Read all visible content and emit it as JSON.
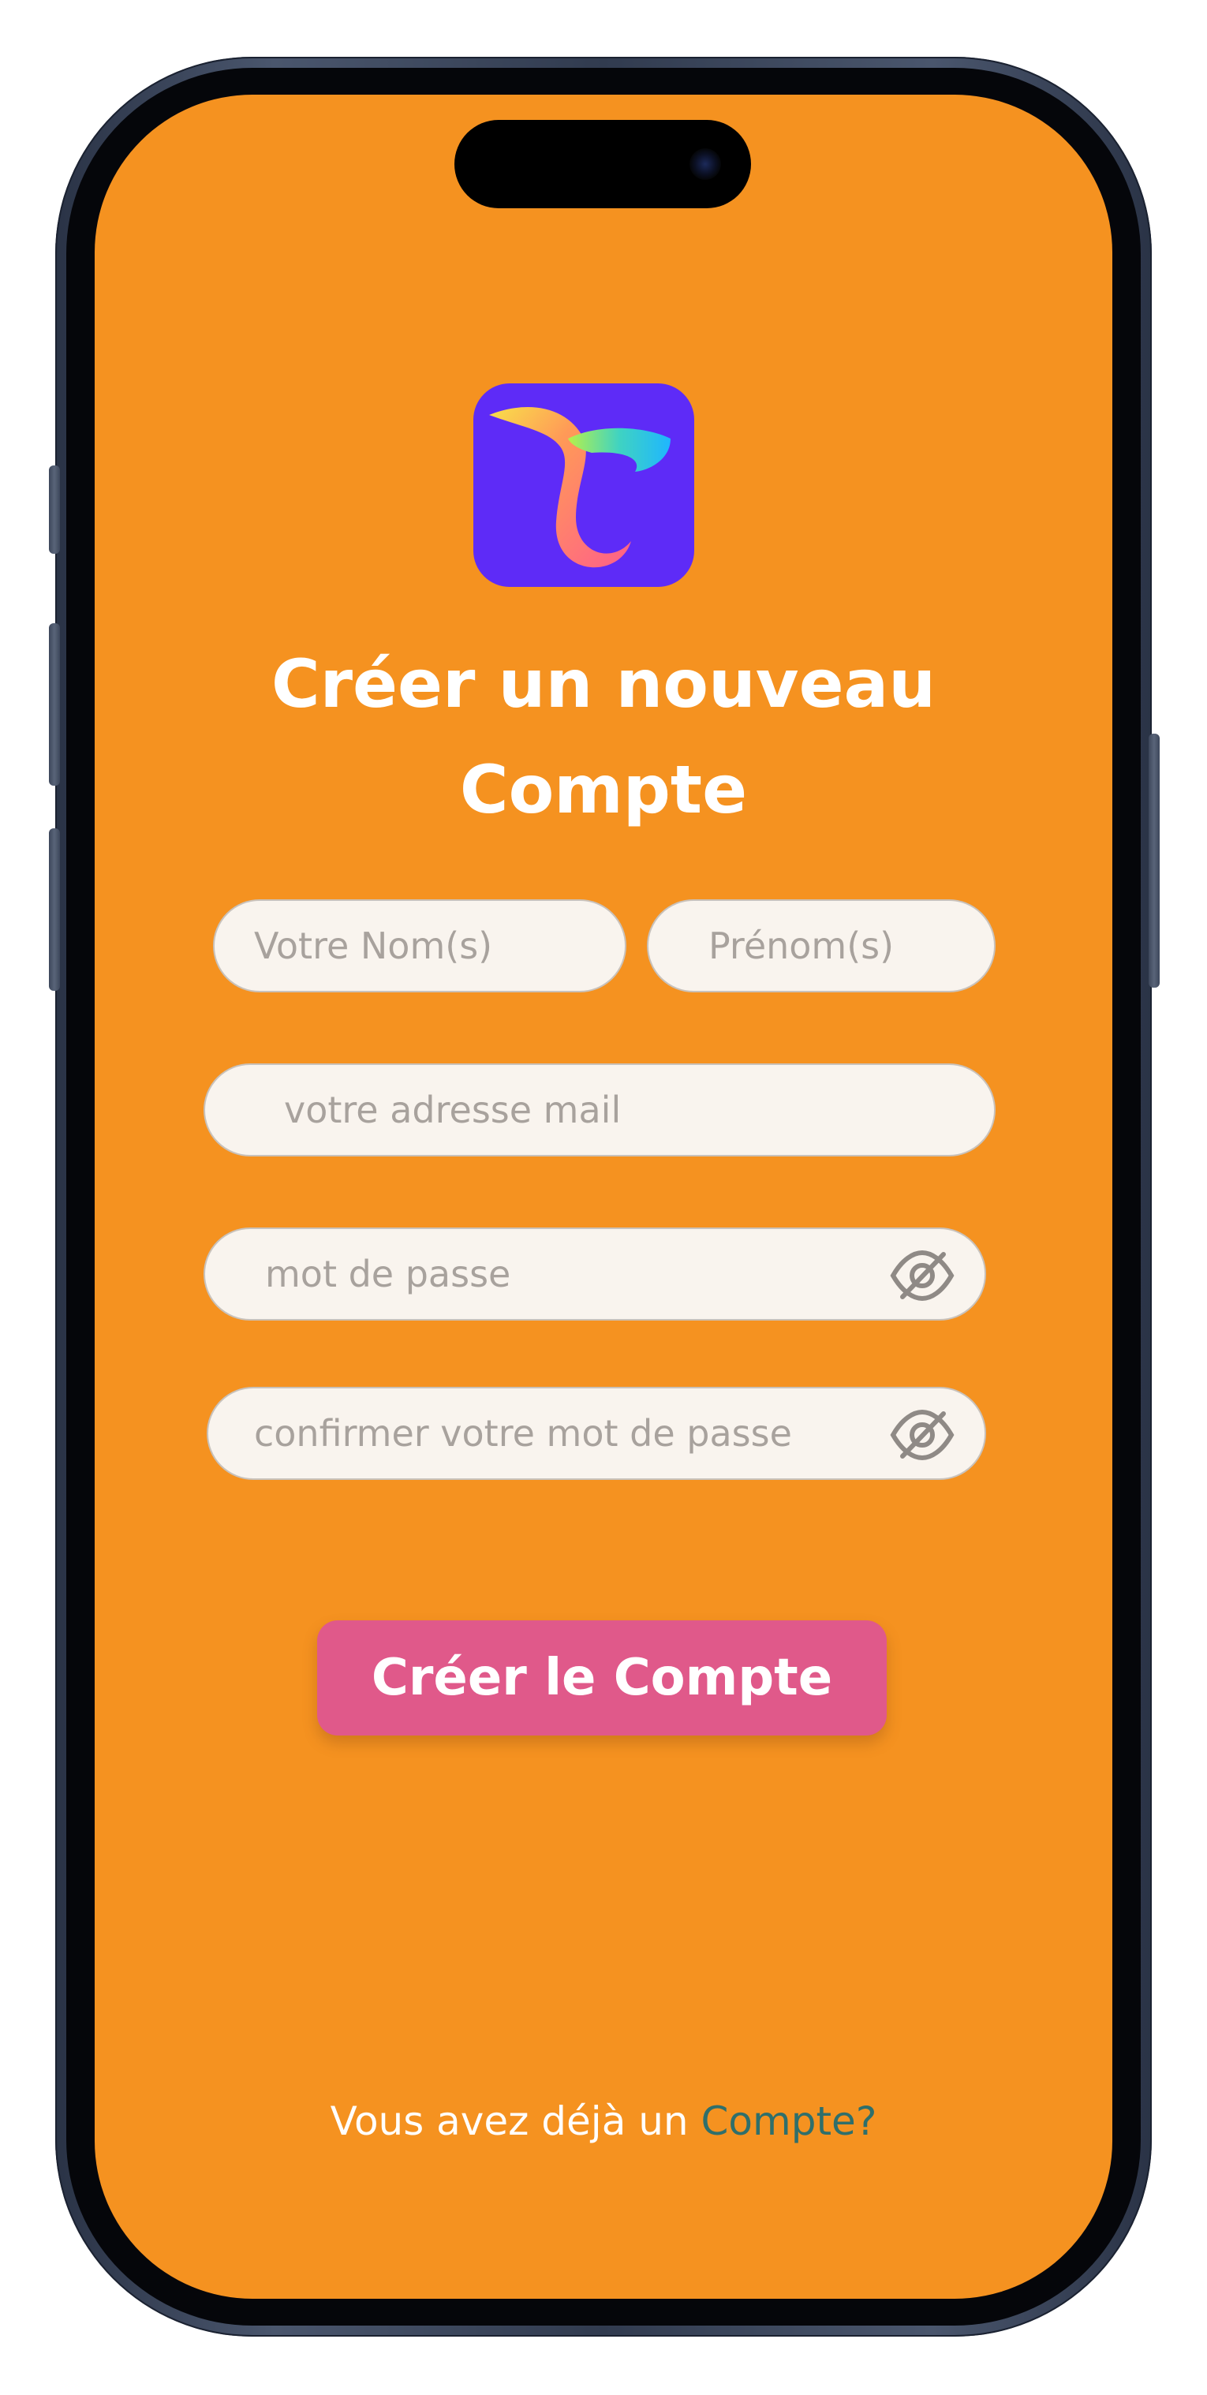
{
  "screen": {
    "background_color": "#f59220"
  },
  "logo": {
    "icon": "app-logo-t",
    "background_color": "#5e2bf7"
  },
  "title": {
    "line1": "Créer un nouveau",
    "line2": "Compte"
  },
  "form": {
    "last_name_placeholder": "Votre Nom(s)",
    "first_name_placeholder": "Prénom(s)",
    "email_placeholder": "votre adresse mail",
    "password_placeholder": "mot de passe",
    "confirm_password_placeholder": "confirmer votre mot de passe",
    "password_toggle_icon": "eye-slash-icon"
  },
  "submit_button": {
    "label": "Créer le Compte",
    "color": "#e0598a"
  },
  "footer": {
    "text": "Vous avez déjà un ",
    "link_label": "Compte?",
    "link_color": "#2f6f6b"
  }
}
